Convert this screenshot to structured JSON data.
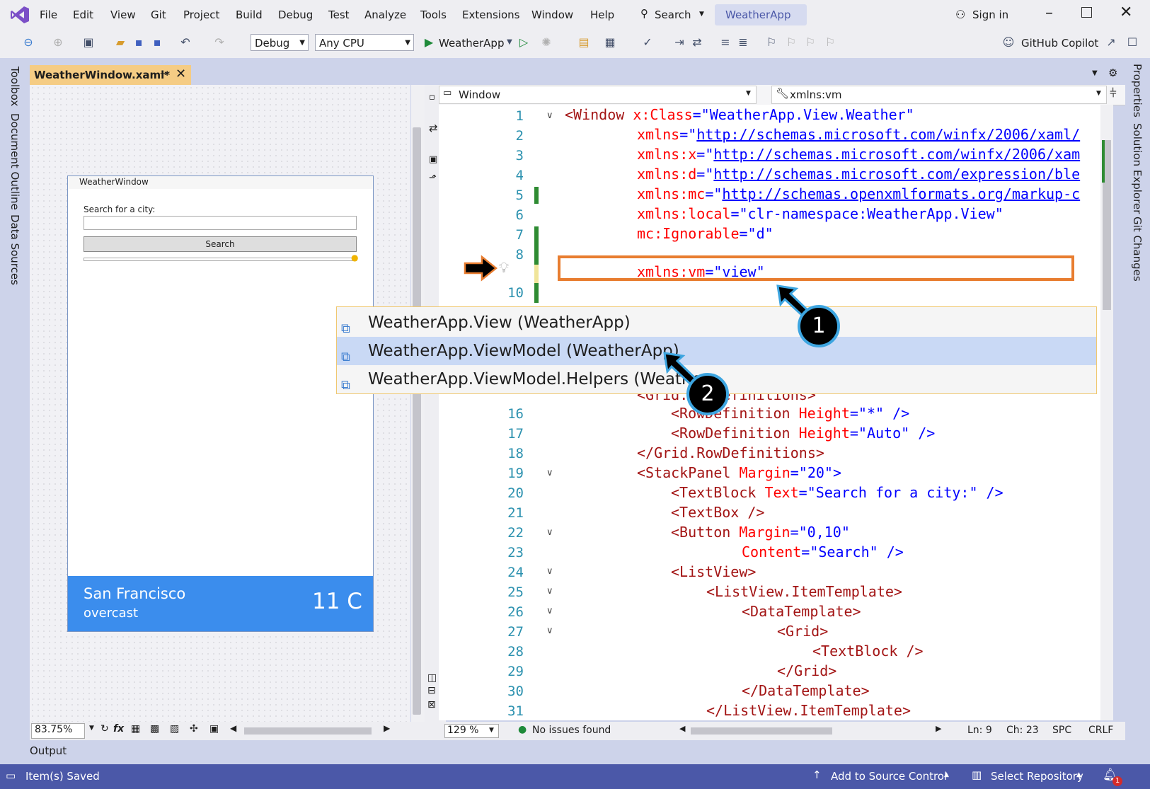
{
  "menu": {
    "items": [
      "File",
      "Edit",
      "View",
      "Git",
      "Project",
      "Build",
      "Debug",
      "Test",
      "Analyze",
      "Tools",
      "Extensions",
      "Window",
      "Help"
    ],
    "search_label": "Search",
    "app_title": "WeatherApp",
    "sign_in": "Sign in"
  },
  "toolbar": {
    "config": "Debug",
    "platform": "Any CPU",
    "run_target": "WeatherApp",
    "copilot": "GitHub Copilot"
  },
  "side_left": [
    "Toolbox",
    "Document Outline",
    "Data Sources"
  ],
  "side_right": [
    "Properties",
    "Solution Explorer",
    "Git Changes"
  ],
  "doc_tab": {
    "title": "WeatherWindow.xaml*"
  },
  "designer": {
    "window_title": "WeatherWindow",
    "search_label": "Search for a city:",
    "search_button": "Search",
    "city": "San Francisco",
    "condition": "overcast",
    "temperature": "11 C",
    "zoom": "83.75%"
  },
  "editor": {
    "element_combo": "Window",
    "member_combo": "xmlns:vm",
    "zoom": "129 %",
    "issues": "No issues found",
    "ln": "Ln: 9",
    "ch": "Ch: 23",
    "spc": "SPC",
    "crlf": "CRLF"
  },
  "code_lines": {
    "l1a": "<Window",
    "l1b": " x:Class",
    "l1c": "=\"WeatherApp.View.Weather\"",
    "l2a": "xmlns",
    "l2b": "=\"",
    "l2c": "http://schemas.microsoft.com/winfx/2006/xaml/",
    "l3a": "xmlns:x",
    "l3c": "http://schemas.microsoft.com/winfx/2006/xam",
    "l4a": "xmlns:d",
    "l4c": "http://schemas.microsoft.com/expression/ble",
    "l5a": "xmlns:mc",
    "l5c": "http://schemas.openxmlformats.org/markup-c",
    "l6a": "xmlns:local",
    "l6c": "=\"clr-namespace:WeatherApp.View\"",
    "l7a": "mc:Ignorable",
    "l7c": "=\"d\"",
    "l9a": "xmlns:vm",
    "l9c": "=\"view\"",
    "l15": "<Grid.RowDefinitions>",
    "l16a": "<RowDefinition",
    "l16b": " Height",
    "l16c": "=\"*\" />",
    "l17a": "<RowDefinition",
    "l17b": " Height",
    "l17c": "=\"Auto\" />",
    "l18": "</Grid.RowDefinitions>",
    "l19a": "<StackPanel",
    "l19b": " Margin",
    "l19c": "=\"20\">",
    "l20a": "<TextBlock",
    "l20b": " Text",
    "l20c": "=\"Search for a city:\" />",
    "l21": "<TextBox />",
    "l22a": "<Button",
    "l22b": " Margin",
    "l22c": "=\"0,10\"",
    "l23b": "Content",
    "l23c": "=\"Search\" />",
    "l24": "<ListView>",
    "l25": "<ListView.ItemTemplate>",
    "l26": "<DataTemplate>",
    "l27": "<Grid>",
    "l28": "<TextBlock />",
    "l29": "</Grid>",
    "l30": "</DataTemplate>",
    "l31": "</ListView.ItemTemplate>"
  },
  "line_numbers": [
    "1",
    "2",
    "3",
    "4",
    "5",
    "6",
    "7",
    "8",
    "10",
    "16",
    "17",
    "18",
    "19",
    "20",
    "21",
    "22",
    "23",
    "24",
    "25",
    "26",
    "27",
    "28",
    "29",
    "30",
    "31"
  ],
  "completion": [
    "WeatherApp.View (WeatherApp)",
    "WeatherApp.ViewModel (WeatherApp)",
    "WeatherApp.ViewModel.Helpers (Weathe"
  ],
  "callouts": [
    "1",
    "2"
  ],
  "output_tab": "Output",
  "status": {
    "saved": "Item(s) Saved",
    "source_control": "Add to Source Control",
    "repository": "Select Repository",
    "notifications": "1"
  },
  "colors": {
    "accent": "#4b58a8",
    "callout_ring": "#3da5e0",
    "highlight_box": "#e87d30",
    "designer_footer": "#3b8ded"
  }
}
